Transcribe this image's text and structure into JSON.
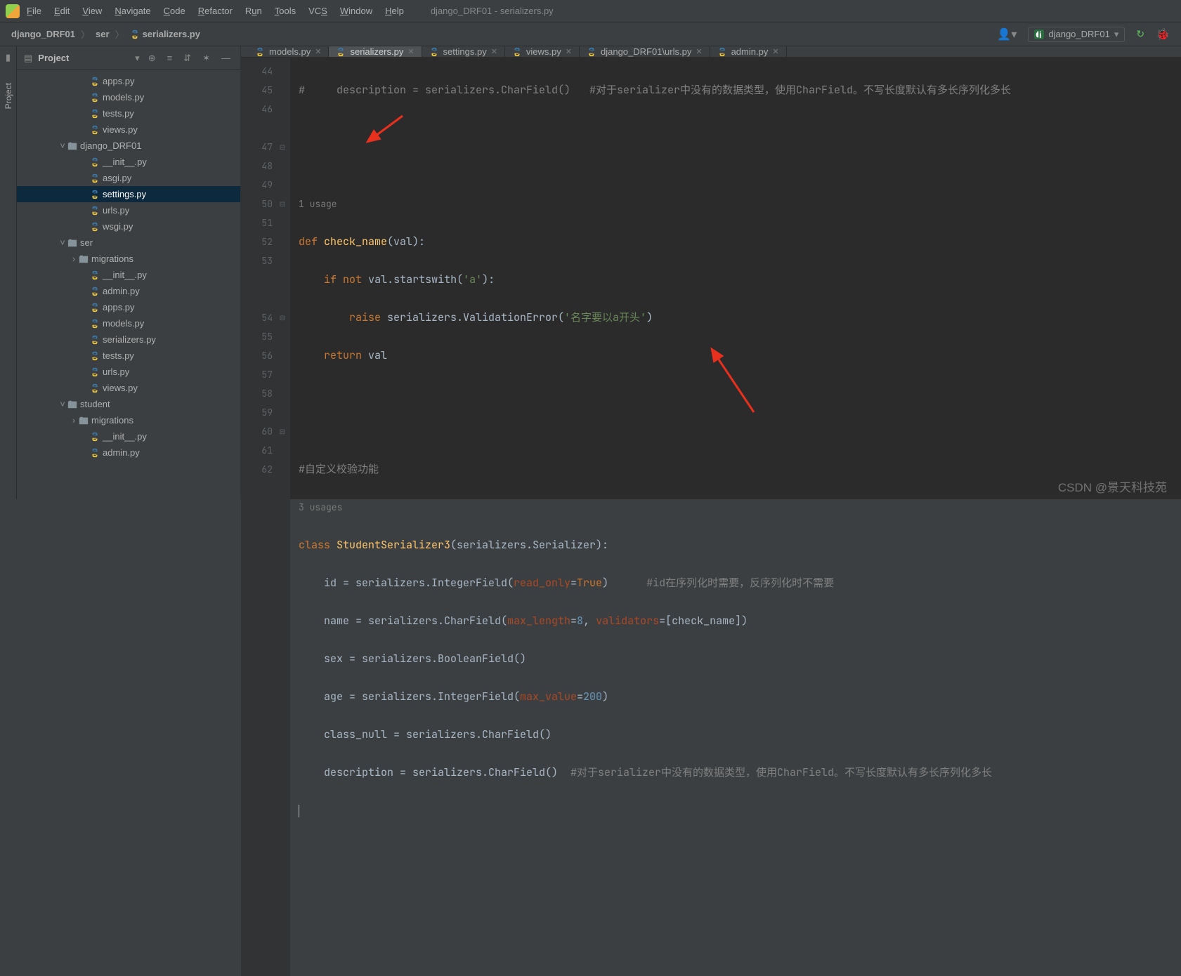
{
  "window": {
    "title": "django_DRF01 - serializers.py"
  },
  "menus": {
    "file": "File",
    "edit": "Edit",
    "view": "View",
    "navigate": "Navigate",
    "code": "Code",
    "refactor": "Refactor",
    "run": "Run",
    "tools": "Tools",
    "vcs": "VCS",
    "window": "Window",
    "help": "Help"
  },
  "breadcrumbs": {
    "root": "django_DRF01",
    "mid": "ser",
    "file": "serializers.py"
  },
  "run_config": {
    "label": "django_DRF01"
  },
  "side_panel": {
    "label": "Project"
  },
  "tree_header": {
    "title": "Project"
  },
  "tree": [
    {
      "indent": 5,
      "type": "py",
      "name": "apps.py"
    },
    {
      "indent": 5,
      "type": "py",
      "name": "models.py"
    },
    {
      "indent": 5,
      "type": "py",
      "name": "tests.py"
    },
    {
      "indent": 5,
      "type": "py",
      "name": "views.py"
    },
    {
      "indent": 3,
      "type": "dir",
      "arrow": "down",
      "name": "django_DRF01"
    },
    {
      "indent": 5,
      "type": "py",
      "name": "__init__.py"
    },
    {
      "indent": 5,
      "type": "py",
      "name": "asgi.py"
    },
    {
      "indent": 5,
      "type": "py",
      "name": "settings.py",
      "sel": true
    },
    {
      "indent": 5,
      "type": "py",
      "name": "urls.py"
    },
    {
      "indent": 5,
      "type": "py",
      "name": "wsgi.py"
    },
    {
      "indent": 3,
      "type": "dir",
      "arrow": "down",
      "name": "ser"
    },
    {
      "indent": 4,
      "type": "dir",
      "arrow": "right",
      "name": "migrations"
    },
    {
      "indent": 5,
      "type": "py",
      "name": "__init__.py"
    },
    {
      "indent": 5,
      "type": "py",
      "name": "admin.py"
    },
    {
      "indent": 5,
      "type": "py",
      "name": "apps.py"
    },
    {
      "indent": 5,
      "type": "py",
      "name": "models.py"
    },
    {
      "indent": 5,
      "type": "py",
      "name": "serializers.py"
    },
    {
      "indent": 5,
      "type": "py",
      "name": "tests.py"
    },
    {
      "indent": 5,
      "type": "py",
      "name": "urls.py"
    },
    {
      "indent": 5,
      "type": "py",
      "name": "views.py"
    },
    {
      "indent": 3,
      "type": "dir",
      "arrow": "down",
      "name": "student"
    },
    {
      "indent": 4,
      "type": "dir",
      "arrow": "right",
      "name": "migrations"
    },
    {
      "indent": 5,
      "type": "py",
      "name": "__init__.py"
    },
    {
      "indent": 5,
      "type": "py",
      "name": "admin.py"
    }
  ],
  "tabs": [
    {
      "label": "models.py",
      "active": false
    },
    {
      "label": "serializers.py",
      "active": true
    },
    {
      "label": "settings.py",
      "active": false
    },
    {
      "label": "views.py",
      "active": false
    },
    {
      "label": "django_DRF01\\urls.py",
      "active": false
    },
    {
      "label": "admin.py",
      "active": false
    }
  ],
  "gutter_lines": [
    "44",
    "45",
    "46",
    "",
    "47",
    "48",
    "49",
    "50",
    "51",
    "52",
    "53",
    "",
    "",
    "54",
    "55",
    "56",
    "57",
    "58",
    "59",
    "60",
    "61",
    "62"
  ],
  "code": {
    "l44_a": "#     description = serializers.CharField()   ",
    "l44_b": "#对于serializer中没有的数据类型，使用CharField。不写长度默认有多长序列化多长",
    "hint1": "1 usage",
    "def": "def",
    "fname": "check_name",
    "params": "(val):",
    "if": "if",
    "not": "not",
    "startswith": " val.startswith(",
    "a": "'a'",
    "p2": "):",
    "raise": "raise",
    "err": " serializers.ValidationError(",
    "errstr": "'名字要以a开头'",
    "p3": ")",
    "return": "return",
    "retv": " val",
    "cmt2": "#自定义校验功能",
    "hint2": "3 usages",
    "class": "class",
    "cname": "StudentSerializer3",
    "cargs": "(serializers.Serializer):",
    "l55a": "    id = serializers.IntegerField(",
    "ro": "read_only",
    "eq": "=",
    "true": "True",
    "l55b": ")      ",
    "l55c": "#id在序列化时需要，反序列化时不需要",
    "l56a": "    name = serializers.CharField(",
    "ml": "max_length",
    "l56b": "=",
    "l56n": "8",
    "l56c": ", ",
    "vld": "validators",
    "l56d": "=[check_name])",
    "l57": "    sex = serializers.BooleanField()",
    "l58a": "    age = serializers.IntegerField(",
    "mv": "max_value",
    "l58b": "=",
    "l58n": "200",
    "l58c": ")",
    "l59": "    class_null = serializers.CharField()",
    "l60a": "    description = serializers.CharField()  ",
    "l60b": "#对于serializer中没有的数据类型，使用CharField。不写长度默认有多长序列化多长"
  },
  "watermark": "CSDN @景天科技苑"
}
